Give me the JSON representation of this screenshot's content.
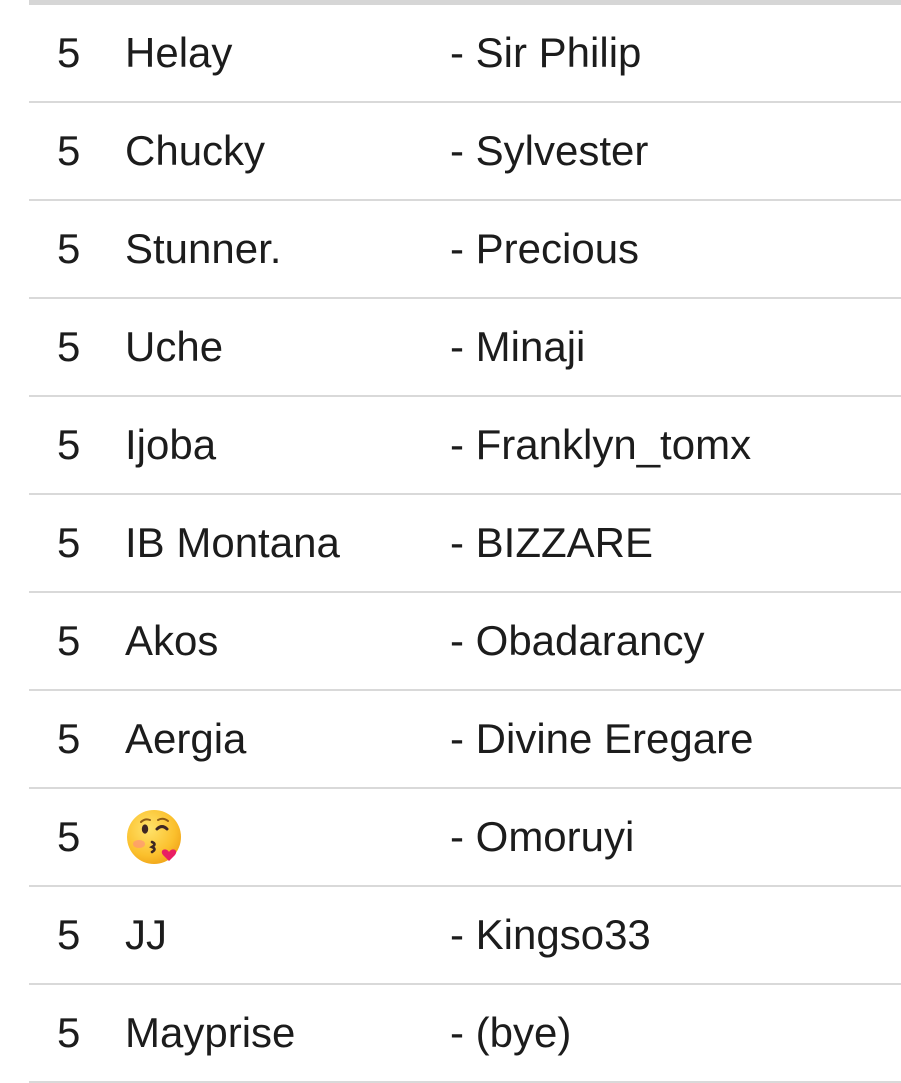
{
  "pairings": [
    {
      "rank": "5",
      "name": "Helay",
      "partner": "- Sir Philip"
    },
    {
      "rank": "5",
      "name": "Chucky",
      "partner": "- Sylvester"
    },
    {
      "rank": "5",
      "name": "Stunner.",
      "partner": "- Precious"
    },
    {
      "rank": "5",
      "name": "Uche",
      "partner": "- Minaji"
    },
    {
      "rank": "5",
      "name": "Ijoba",
      "partner": "- Franklyn_tomx"
    },
    {
      "rank": "5",
      "name": "IB Montana",
      "partner": "- BIZZARE"
    },
    {
      "rank": "5",
      "name": "Akos",
      "partner": "- Obadarancy"
    },
    {
      "rank": "5",
      "name": "Aergia",
      "partner": "- Divine Eregare"
    },
    {
      "rank": "5",
      "name": "",
      "icon": "face-blowing-kiss-emoji-icon",
      "partner": "- Omoruyi"
    },
    {
      "rank": "5",
      "name": "JJ",
      "partner": "- Kingso33"
    },
    {
      "rank": "5",
      "name": "Mayprise",
      "partner": "- (bye)"
    }
  ]
}
